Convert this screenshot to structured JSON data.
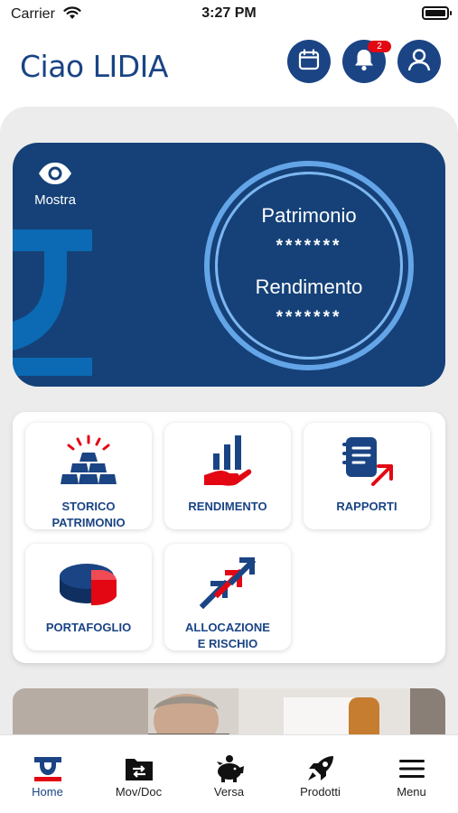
{
  "status_bar": {
    "carrier": "Carrier",
    "time": "3:27 PM"
  },
  "header": {
    "greeting": "Ciao LIDIA",
    "notifications_count": "2",
    "accent_color": "#1a4484",
    "badge_color": "#e30613"
  },
  "summary": {
    "toggle_label": "Mostra",
    "patrimonio_label": "Patrimonio",
    "patrimonio_value": "*******",
    "rendimento_label": "Rendimento",
    "rendimento_value": "*******",
    "card_color": "#154178",
    "ring_color": "#64a5e8"
  },
  "shortcuts": [
    {
      "label": "STORICO\nPATRIMONIO",
      "icon": "gold-bars-icon"
    },
    {
      "label": "RENDIMENTO",
      "icon": "growth-hand-icon"
    },
    {
      "label": "RAPPORTI",
      "icon": "report-icon"
    },
    {
      "label": "PORTAFOGLIO",
      "icon": "pie-chart-icon"
    },
    {
      "label": "ALLOCAZIONE\nE RISCHIO",
      "icon": "allocation-arrows-icon"
    }
  ],
  "bottom_nav": [
    {
      "label": "Home",
      "icon": "home-logo-icon",
      "active": true
    },
    {
      "label": "Mov/Doc",
      "icon": "folder-transfer-icon",
      "active": false
    },
    {
      "label": "Versa",
      "icon": "piggy-bank-icon",
      "active": false
    },
    {
      "label": "Prodotti",
      "icon": "rocket-icon",
      "active": false
    },
    {
      "label": "Menu",
      "icon": "hamburger-menu-icon",
      "active": false
    }
  ]
}
